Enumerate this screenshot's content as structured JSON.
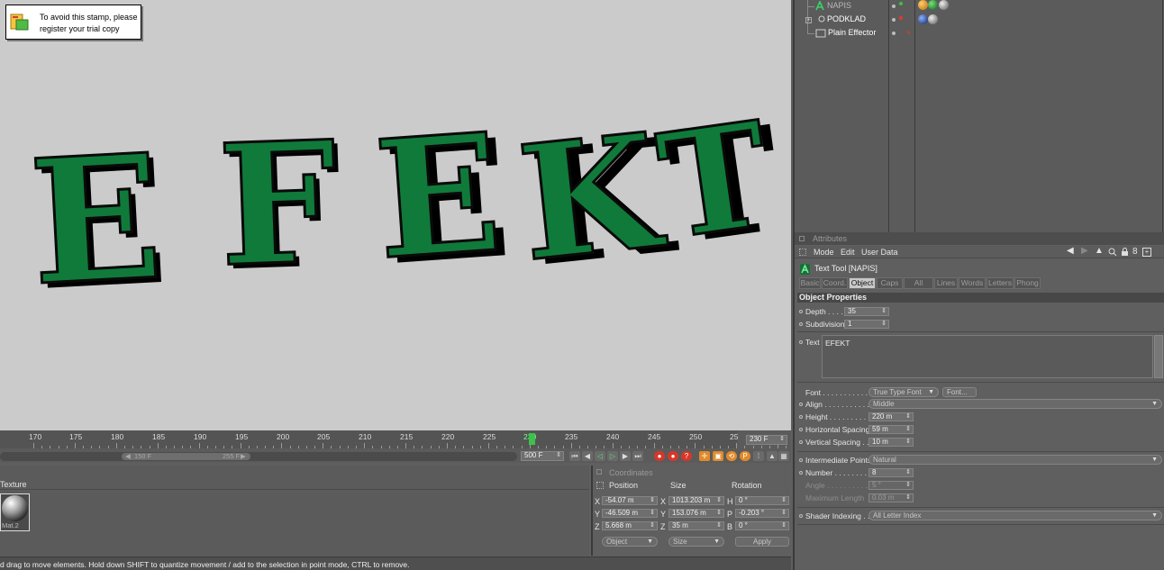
{
  "stamp": {
    "line1": "To avoid this stamp, please",
    "line2": "register your trial copy"
  },
  "viewport": {
    "scene_text": "EFEKT",
    "letters": [
      "E",
      "F",
      "E",
      "K",
      "T"
    ],
    "letter_color": "#107a3a"
  },
  "object_manager": {
    "objects": [
      {
        "name": "NAPIS",
        "active": true
      },
      {
        "name": "PODKLAD",
        "active": false
      },
      {
        "name": "Plain Effector",
        "active": false
      }
    ]
  },
  "attributes": {
    "title": "Attributes",
    "menu": [
      "Mode",
      "Edit",
      "User Data"
    ],
    "object_title": "Text Tool [NAPIS]",
    "tabs": [
      "Basic",
      "Coord.",
      "Object",
      "Caps",
      "All",
      "Lines",
      "Words",
      "Letters",
      "Phong"
    ],
    "active_tab": "Object",
    "section": "Object Properties",
    "depth_label": "Depth . . . .",
    "depth_value": "35",
    "subdivision_label": "Subdivision",
    "subdivision_value": "1",
    "text_label": "Text",
    "text_value": "EFEKT",
    "font_label": "Font . . . . . . . . . . .",
    "font_type": "True Type Font",
    "font_button": "Font...",
    "align_label": "Align . . . . . . . . . . .",
    "align_value": "Middle",
    "height_label": "Height . . . . . . . . . .",
    "height_value": "220 m",
    "hspacing_label": "Horizontal Spacing",
    "hspacing_value": "59 m",
    "vspacing_label": "Vertical Spacing . .",
    "vspacing_value": "10 m",
    "intermediate_label": "Intermediate Points",
    "intermediate_value": "Natural",
    "number_label": "Number . . . . . . . . .",
    "number_value": "8",
    "angle_label": "Angle . . . . . . . . . .",
    "angle_value": "5 °",
    "maxlen_label": "Maximum Length",
    "maxlen_value": "0.03 m",
    "shader_label": "Shader Indexing . .",
    "shader_value": "All Letter Index"
  },
  "timeline": {
    "ticks": [
      "170",
      "175",
      "180",
      "185",
      "190",
      "195",
      "200",
      "205",
      "210",
      "215",
      "220",
      "225",
      "230",
      "235",
      "240",
      "245",
      "250",
      "25"
    ],
    "current_frame": "230 F",
    "end_frame": "500 F",
    "slider_start": "150 F",
    "slider_end": "255 F"
  },
  "material_manager": {
    "column": "Texture",
    "material_name": "Mat.2"
  },
  "coordinates": {
    "title": "Coordinates",
    "headers": [
      "Position",
      "Size",
      "Rotation"
    ],
    "rows": [
      {
        "axis": "X",
        "pos": "-54.07 m",
        "size_axis": "X",
        "size": "1013.203 m",
        "rot_axis": "H",
        "rot": "0 °"
      },
      {
        "axis": "Y",
        "pos": "-46.509 m",
        "size_axis": "Y",
        "size": "153.076 m",
        "rot_axis": "P",
        "rot": "-0.203 °"
      },
      {
        "axis": "Z",
        "pos": "5.668 m",
        "size_axis": "Z",
        "size": "35 m",
        "rot_axis": "B",
        "rot": "0 °"
      }
    ],
    "mode_object": "Object",
    "mode_size": "Size",
    "apply": "Apply"
  },
  "status": "d drag to move elements. Hold down SHIFT to quantize movement / add to the selection in point mode, CTRL to remove."
}
